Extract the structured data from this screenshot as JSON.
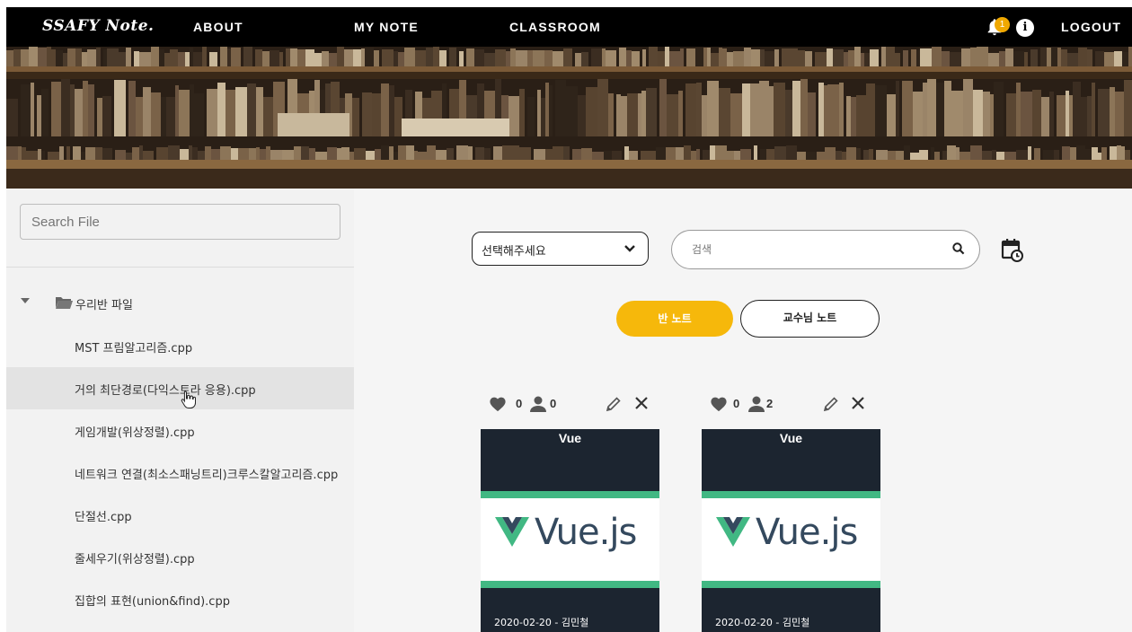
{
  "navbar": {
    "brand": "SSAFY Note.",
    "links": [
      "ABOUT",
      "MY NOTE",
      "CLASSROOM"
    ],
    "notification_count": "1",
    "info_icon": "i",
    "logout": "LOGOUT"
  },
  "sidebar": {
    "search_placeholder": "Search File",
    "root_folder": "우리반 파일",
    "files": [
      "MST 프림알고리즘.cpp",
      "거의 최단경로(다익스트라 응용).cpp",
      "게임개발(위상정렬).cpp",
      "네트워크 연결(최소스패닝트리)크루스칼알고리즘.cpp",
      "단절선.cpp",
      "줄세우기(위상정렬).cpp",
      "집합의 표현(union&find).cpp"
    ],
    "active_index": 1
  },
  "main": {
    "select_value": "선택해주세요",
    "search_placeholder": "검색",
    "tabs": {
      "class_note": "반 노트",
      "professor_note": "교수님 노트"
    },
    "cards": [
      {
        "likes": "0",
        "views": "0",
        "tag": "Vue",
        "logo_text": "Vue.js",
        "meta": "2020-02-20 - 김민철"
      },
      {
        "likes": "0",
        "views": "2",
        "tag": "Vue",
        "logo_text": "Vue.js",
        "meta": "2020-02-20 - 김민철"
      }
    ]
  },
  "colors": {
    "accent": "#f6b80b",
    "vue_green": "#41b883",
    "vue_dark": "#34495e",
    "navbar": "#000000"
  }
}
